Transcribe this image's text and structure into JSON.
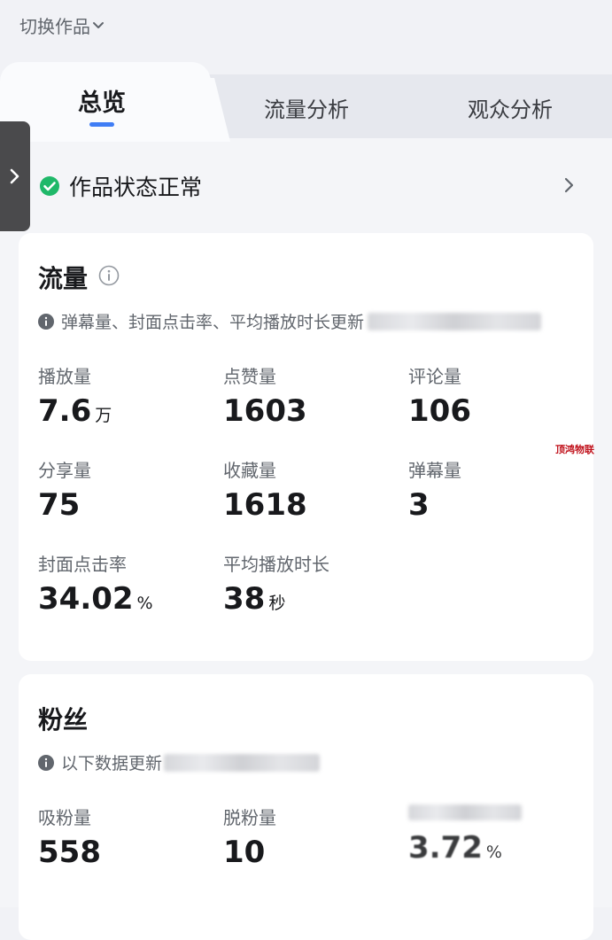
{
  "header": {
    "work_switch_label": "切换作品"
  },
  "tabs": {
    "overview": "总览",
    "traffic": "流量分析",
    "audience": "观众分析"
  },
  "status": {
    "text": "作品状态正常"
  },
  "traffic_card": {
    "title": "流量",
    "note": "弹幕量、封面点击率、平均播放时长更新",
    "metrics": {
      "plays": {
        "label": "播放量",
        "value": "7.6",
        "unit": "万"
      },
      "likes": {
        "label": "点赞量",
        "value": "1603"
      },
      "comments": {
        "label": "评论量",
        "value": "106"
      },
      "shares": {
        "label": "分享量",
        "value": "75"
      },
      "favorites": {
        "label": "收藏量",
        "value": "1618"
      },
      "danmaku": {
        "label": "弹幕量",
        "value": "3"
      },
      "ctr": {
        "label": "封面点击率",
        "value": "34.02",
        "unit": "%"
      },
      "avg_duration": {
        "label": "平均播放时长",
        "value": "38",
        "unit": "秒"
      }
    }
  },
  "fans_card": {
    "title": "粉丝",
    "note": "以下数据更新",
    "metrics": {
      "gained": {
        "label": "吸粉量",
        "value": "558"
      },
      "lost": {
        "label": "脱粉量",
        "value": "10"
      },
      "ratio": {
        "value": "3.72",
        "unit": "%"
      }
    }
  },
  "watermark": {
    "text": "顶鸿物联"
  },
  "colors": {
    "accent": "#3f7df5",
    "status_ok": "#1fb869",
    "handle": "#4a4a4c"
  }
}
